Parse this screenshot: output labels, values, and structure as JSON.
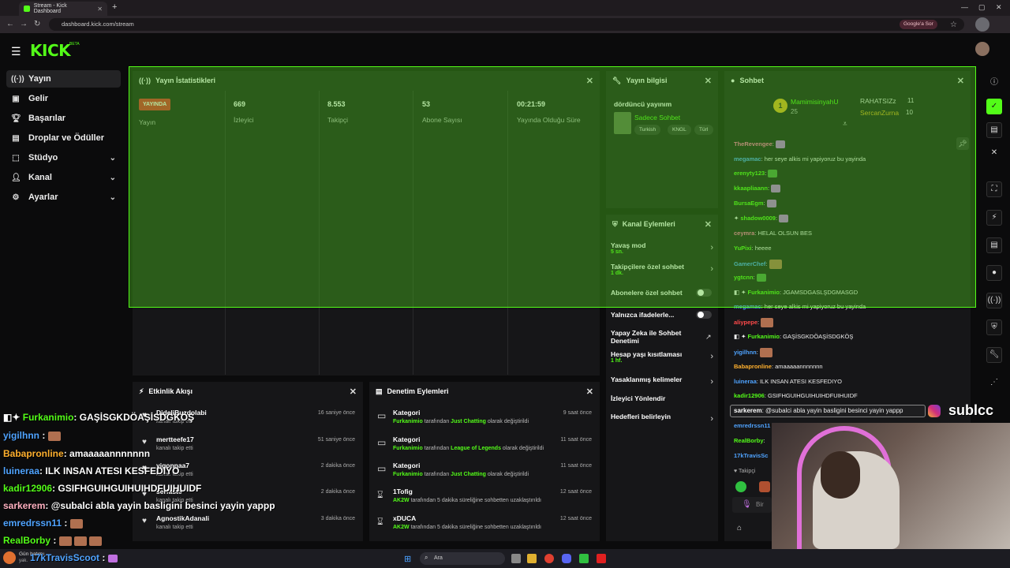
{
  "browser": {
    "tab_title": "Stream - Kick Dashboard",
    "url": "dashboard.kick.com/stream",
    "google_chip": "Google'a Sor"
  },
  "brand": {
    "logo": "KICK",
    "beta": "BETA",
    "accent": "#53fc18"
  },
  "sidebar": {
    "items": [
      {
        "label": "Yayın",
        "icon": "broadcast-icon"
      },
      {
        "label": "Gelir",
        "icon": "wallet-icon"
      },
      {
        "label": "Başarılar",
        "icon": "trophy-icon"
      },
      {
        "label": "Droplar ve Ödüller",
        "icon": "gift-icon"
      },
      {
        "label": "Stüdyo",
        "icon": "studio-icon"
      },
      {
        "label": "Kanal",
        "icon": "user-icon"
      },
      {
        "label": "Ayarlar",
        "icon": "gear-icon"
      }
    ]
  },
  "stats": {
    "title": "Yayın İstatistikleri",
    "live_badge": "YAYINDA",
    "live_label": "Yayın",
    "viewers": "669",
    "viewers_label": "İzleyici",
    "followers": "8.553",
    "followers_label": "Takipçi",
    "subs": "53",
    "subs_label": "Abone Sayısı",
    "duration": "00:21:59",
    "duration_label": "Yayında Olduğu Süre"
  },
  "stream_info": {
    "title": "Yayın bilgisi",
    "stream_title": "dördüncü yayınım",
    "category": "Sadece Sohbet",
    "tags": [
      "Turkish",
      "KNGL",
      "Türl"
    ]
  },
  "channel_actions": {
    "title": "Kanal Eylemleri",
    "rows": [
      {
        "label": "Yavaş mod",
        "value": "5 sn."
      },
      {
        "label": "Takipçilere özel sohbet",
        "value": "1 dk."
      },
      {
        "label": "Abonelere özel sohbet",
        "value": ""
      },
      {
        "label": "Yalnızca ifadelerle...",
        "value": ""
      },
      {
        "label": "Yapay Zeka ile Sohbet Denetimi",
        "value": ""
      },
      {
        "label": "Hesap yaşı kısıtlaması",
        "value": "1 hf."
      },
      {
        "label": "Yasaklanmış kelimeler",
        "value": ""
      },
      {
        "label": "İzleyici Yönlendir",
        "value": ""
      },
      {
        "label": "Hedefleri belirleyin",
        "value": ""
      }
    ]
  },
  "activity": {
    "title": "Etkinlik Akışı",
    "rows": [
      {
        "name": "DideliBuzdolabi",
        "sub": "kanalı takip etti",
        "time": "16 saniye önce"
      },
      {
        "name": "mertteefe17",
        "sub": "kanalı takip etti",
        "time": "51 saniye önce"
      },
      {
        "name": "yigonnaa7",
        "sub": "kanalı takip etti",
        "time": "2 dakika önce"
      },
      {
        "name": "serfaste",
        "sub": "kanalı takip etti",
        "time": "2 dakika önce"
      },
      {
        "name": "AgnostikAdanali",
        "sub": "kanalı takip etti",
        "time": "3 dakika önce"
      }
    ]
  },
  "moderation": {
    "title": "Denetim Eylemleri",
    "rows": [
      {
        "name": "Kategori",
        "actor": "Furkanimio",
        "mid": "tarafından",
        "target": "Just Chatting",
        "tail": "olarak değiştirildi",
        "time": "9 saat önce"
      },
      {
        "name": "Kategori",
        "actor": "Furkanimio",
        "mid": "tarafından",
        "target": "League of Legends",
        "tail": "olarak değiştirildi",
        "time": "11 saat önce"
      },
      {
        "name": "Kategori",
        "actor": "Furkanimio",
        "mid": "tarafından",
        "target": "Just Chatting",
        "tail": "olarak değiştirildi",
        "time": "11 saat önce"
      },
      {
        "name": "1Tofig",
        "actor": "AK2W",
        "mid": "tarafından 5 dakika süreliğine sohbetten uzaklaştırıldı",
        "target": "",
        "tail": "",
        "time": "12 saat önce"
      },
      {
        "name": "xDUCA",
        "actor": "AK2W",
        "mid": "tarafından 5 dakika süreliğine sohbetten uzaklaştırıldı",
        "target": "",
        "tail": "",
        "time": "12 saat önce"
      }
    ]
  },
  "chat": {
    "title": "Sohbet",
    "top1_name": "MamimisinyahU",
    "top1_count": "25",
    "top2_name": "RAHATSIZz",
    "top2_count": "11",
    "top3_name": "SercanZurna",
    "top3_count": "10",
    "messages": [
      {
        "user": "TheRevengee",
        "color": "#ff6bb0",
        "text": ""
      },
      {
        "user": "megamac",
        "color": "#4fa3ff",
        "text": "her seye alkis mi yapiyoruz bu yayinda"
      },
      {
        "user": "erenyty123",
        "color": "#53fc18",
        "text": ""
      },
      {
        "user": "kkaapliaann",
        "color": "#53fc18",
        "text": ""
      },
      {
        "user": "BursaEgm",
        "color": "#53fc18",
        "text": ""
      },
      {
        "user": "shadow0009",
        "color": "#53fc18",
        "text": ""
      },
      {
        "user": "ceymra",
        "color": "#ff6bb0",
        "text": "HELAL OLSUN BES"
      },
      {
        "user": "YuPixi",
        "color": "#53fc18",
        "text": "heeee"
      },
      {
        "user": "GamerChef",
        "color": "#4fa3ff",
        "text": ""
      },
      {
        "user": "ygtcnn",
        "color": "#53fc18",
        "text": ""
      },
      {
        "user": "Furkanimio",
        "color": "#53fc18",
        "text": "JGAMSDGASLŞDGMASGD"
      },
      {
        "user": "megamac",
        "color": "#4fa3ff",
        "text": "her seye alkis mi yapiyoruz bu yayinda"
      },
      {
        "user": "aliypepe",
        "color": "#ff4a4a",
        "text": ""
      },
      {
        "user": "Furkanimio",
        "color": "#53fc18",
        "text": "GAŞİSGKDÖAŞİSDGKÖŞ"
      },
      {
        "user": "yigilhnn",
        "color": "#4fa3ff",
        "text": ""
      },
      {
        "user": "Babapronline",
        "color": "#ffb02e",
        "text": "amaaaaannnnnnn"
      },
      {
        "user": "luineraa",
        "color": "#4fa3ff",
        "text": "ILK INSAN ATESI KESFEDIYO"
      },
      {
        "user": "kadir12906",
        "color": "#53fc18",
        "text": "GSIFHGUIHGUIHUIHDFUIHUIDF"
      },
      {
        "user": "sarkerem",
        "color": "#ffffff",
        "text": "@subalci abla yayin basligini besinci yayin yappp"
      },
      {
        "user": "emredrssn11",
        "color": "#4fa3ff",
        "text": ""
      },
      {
        "user": "RealBorby",
        "color": "#53fc18",
        "text": ""
      },
      {
        "user": "17kTravisSc",
        "color": "#4fa3ff",
        "text": ""
      }
    ],
    "followers_line": "Takipçi",
    "input_placeholder": "Bir"
  },
  "overlay_chat": [
    {
      "user": "Furkanimio",
      "color": "#53fc18",
      "text": ": GAŞİSGKDÖAŞİSDGKÖŞ"
    },
    {
      "user": "yigilhnn",
      "color": "#4fa3ff",
      "text": " :"
    },
    {
      "user": "Babapronline",
      "color": "#ffb02e",
      "text": ": amaaaaannnnnnn"
    },
    {
      "user": "luineraa",
      "color": "#4fa3ff",
      "text": ": ILK INSAN ATESI KESFEDIYO"
    },
    {
      "user": "kadir12906",
      "color": "#53fc18",
      "text": ": GSIFHGUIHGUIHUIHDFUIHUIDF"
    },
    {
      "user": "sarkerem",
      "color": "#ffb0c0",
      "text": ": @subalci abla yayin basligini besinci yayin yappp"
    },
    {
      "user": "emredrssn11",
      "color": "#4fa3ff",
      "text": " :"
    },
    {
      "user": "RealBorby",
      "color": "#53fc18",
      "text": " :"
    },
    {
      "user": "17kTravisScoot",
      "color": "#4fa3ff",
      "text": " :"
    }
  ],
  "watermark": "sublcc",
  "taskbar": {
    "search": "Ara",
    "weather": "Gün batımı",
    "weather_sub": "yak."
  }
}
